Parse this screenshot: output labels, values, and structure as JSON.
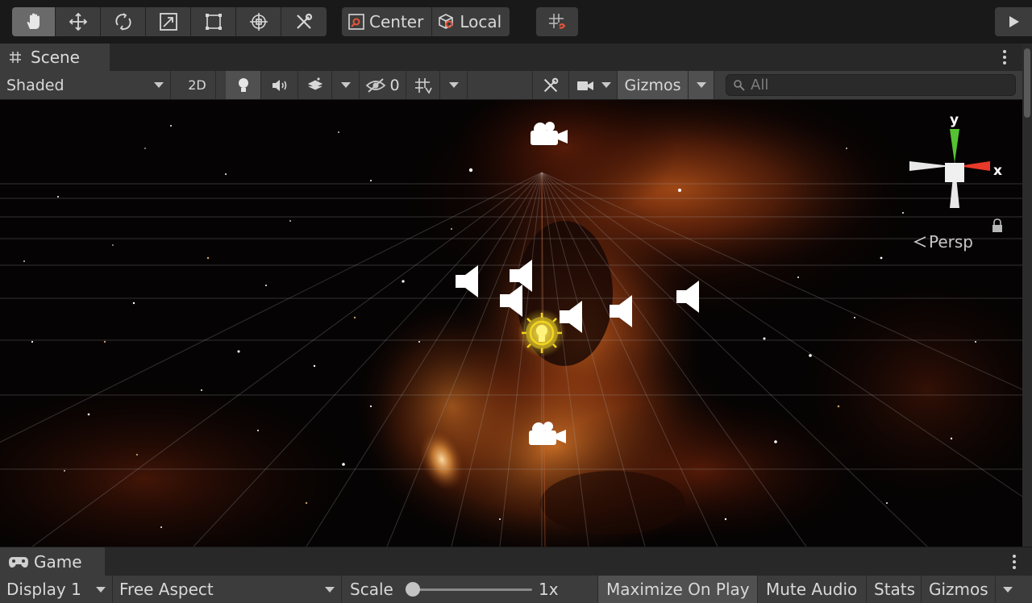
{
  "main_toolbar": {
    "tools": [
      "hand-tool",
      "move-tool",
      "rotate-tool",
      "scale-tool",
      "rect-tool",
      "transform-tool",
      "custom-tool"
    ],
    "pivot_label": "Center",
    "space_label": "Local"
  },
  "scene": {
    "tab_label": "Scene",
    "shading_mode": "Shaded",
    "mode_2d": "2D",
    "hidden_count": "0",
    "gizmos_label": "Gizmos",
    "search_placeholder": "All",
    "view_gizmo": {
      "y_label": "y",
      "x_label": "x",
      "projection": "Persp"
    },
    "colors": {
      "x_axis": "#e8392b",
      "y_axis": "#55c331",
      "light": "#f3d51d"
    }
  },
  "game": {
    "tab_label": "Game",
    "display": "Display 1",
    "aspect": "Free Aspect",
    "scale_label": "Scale",
    "scale_value": "1x",
    "maximize": "Maximize On Play",
    "mute": "Mute Audio",
    "stats": "Stats",
    "gizmos": "Gizmos"
  }
}
